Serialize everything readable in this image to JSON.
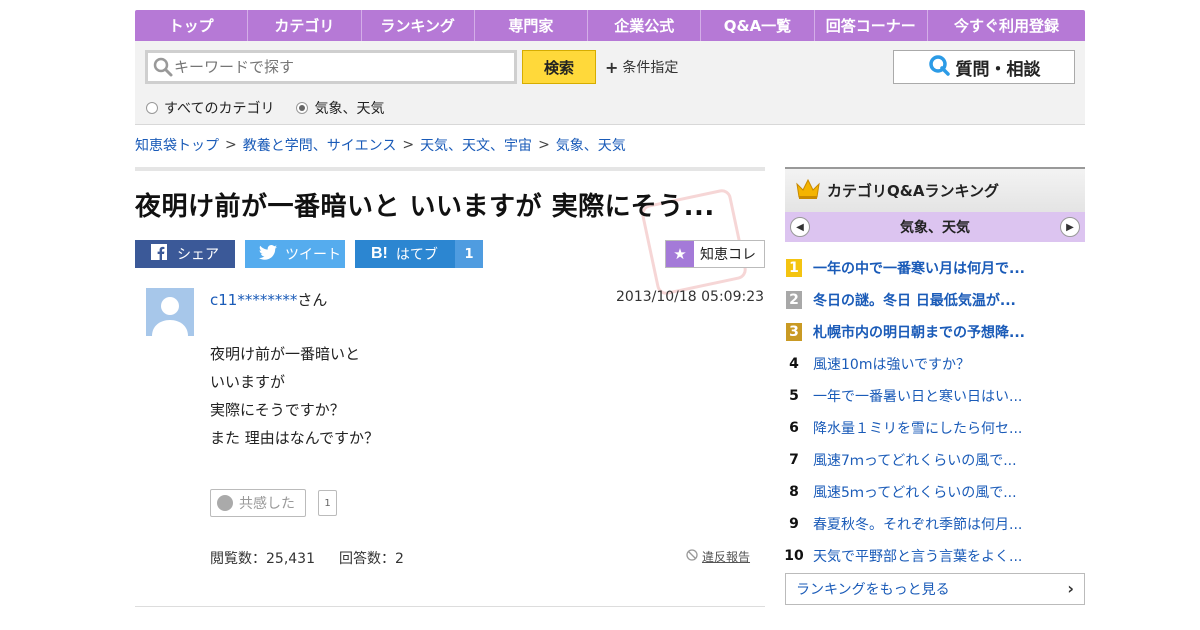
{
  "nav": {
    "items": [
      "トップ",
      "カテゴリ",
      "ランキング",
      "専門家",
      "企業公式",
      "Q&A一覧",
      "回答コーナー",
      "今すぐ利用登録"
    ]
  },
  "search": {
    "placeholder": "キーワードで探す",
    "button": "検索",
    "condition": "条件指定",
    "ask_button": "質問・相談",
    "radio_all": "すべてのカテゴリ",
    "radio_current": "気象、天気"
  },
  "breadcrumb": {
    "items": [
      "知恵袋トップ",
      "教養と学問、サイエンス",
      "天気、天文、宇宙",
      "気象、天気"
    ],
    "sep": ">"
  },
  "question": {
    "title": "夜明け前が一番暗いと いいますが 実際にそう...",
    "user": "c11********",
    "user_suffix": "さん",
    "date": "2013/10/18  05:09:23",
    "body": [
      "夜明け前が一番暗いと",
      "いいますが",
      "実際にそうですか？",
      "また 理由はなんですか？"
    ],
    "kyokan_label": "共感した",
    "kyokan_count": "1",
    "views_label": "閲覧数：25,431",
    "answers_label": "回答数：2",
    "report": "違反報告"
  },
  "share": {
    "facebook": "シェア",
    "twitter": "ツイート",
    "hatena": "はてブ",
    "hatena_count": "1",
    "chiekore": "知恵コレ"
  },
  "sidebar": {
    "title": "カテゴリQ&Aランキング",
    "category": "気象、天気",
    "ranking": [
      {
        "rank": "1",
        "text": "一年の中で一番寒い月は何月で..."
      },
      {
        "rank": "2",
        "text": "冬日の謎。冬日 日最低気温が..."
      },
      {
        "rank": "3",
        "text": "札幌市内の明日朝までの予想降..."
      },
      {
        "rank": "4",
        "text": "風速10mは強いですか？"
      },
      {
        "rank": "5",
        "text": "一年で一番暑い日と寒い日はい..."
      },
      {
        "rank": "6",
        "text": "降水量１ミリを雪にしたら何セ..."
      },
      {
        "rank": "7",
        "text": "風速7ｍってどれくらいの風で..."
      },
      {
        "rank": "8",
        "text": "風速5ｍってどれくらいの風で..."
      },
      {
        "rank": "9",
        "text": "春夏秋冬。それぞれ季節は何月..."
      },
      {
        "rank": "10",
        "text": "天気で平野部と言う言葉をよく..."
      }
    ],
    "more": "ランキングをもっと見る"
  },
  "colors": {
    "nav_bg": "#b679d6",
    "search_button": "#ffd93a",
    "link": "#1a5bb8",
    "facebook": "#3b5998",
    "twitter": "#55acee",
    "hatena": "#2c86d1"
  }
}
